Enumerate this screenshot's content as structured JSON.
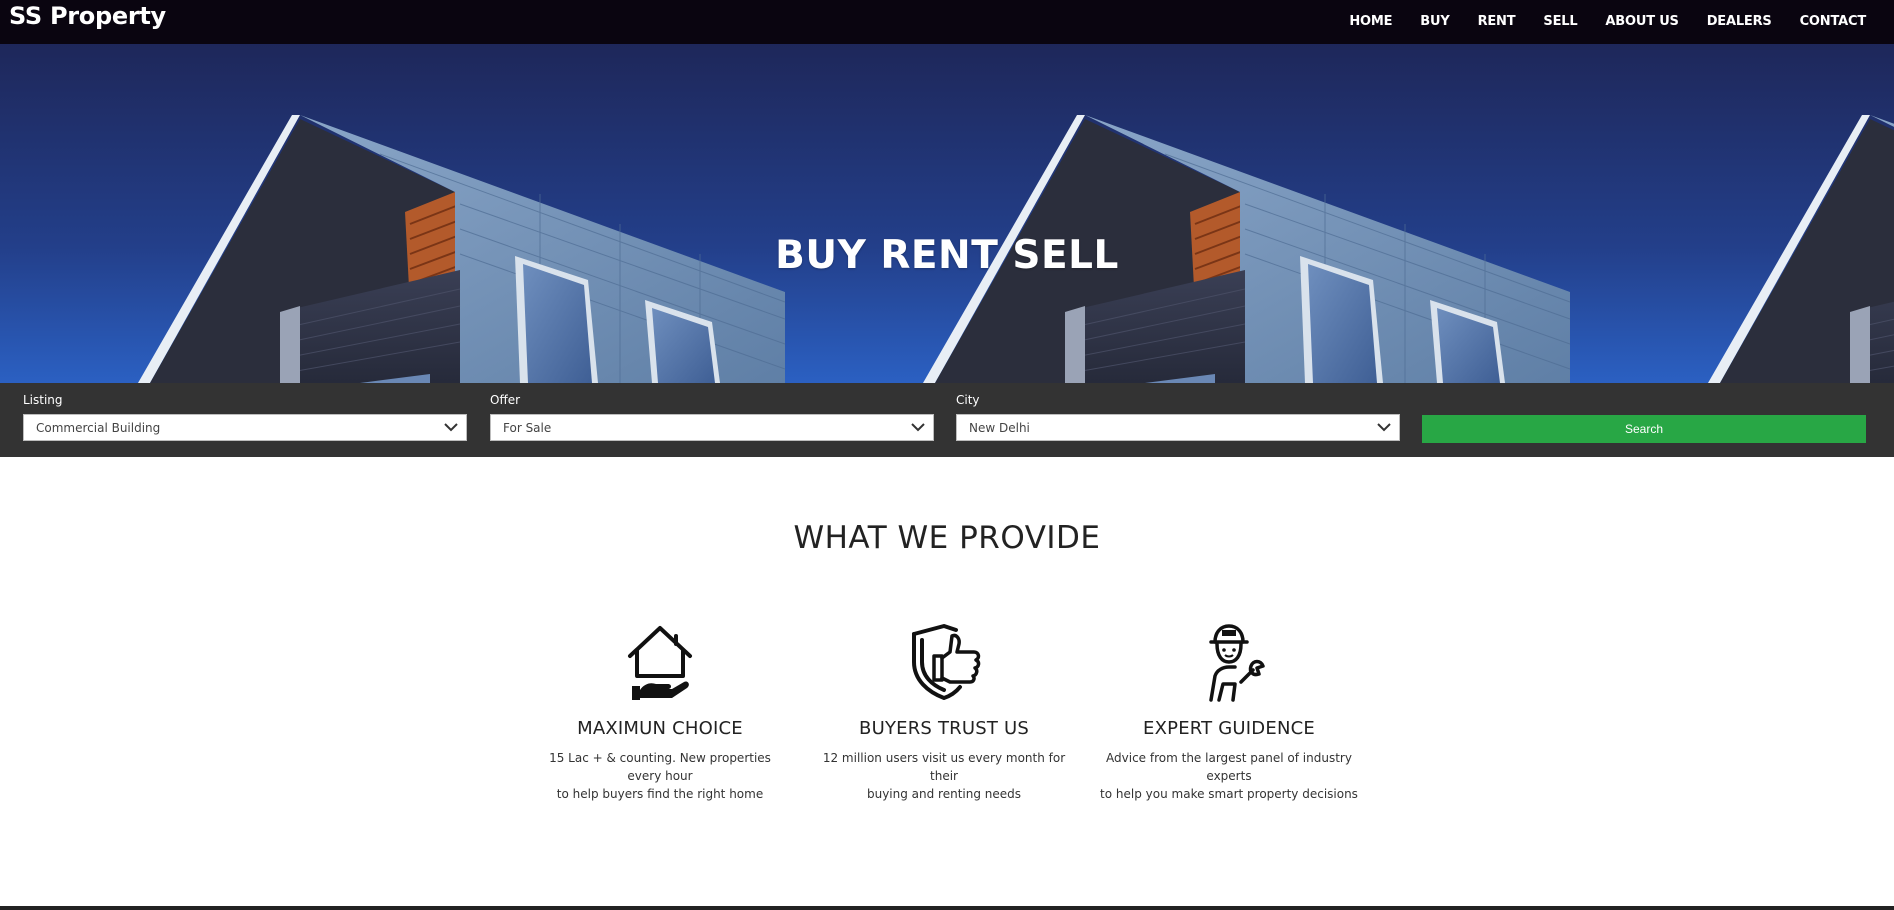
{
  "brand": {
    "name": "SS Property"
  },
  "nav": {
    "items": [
      {
        "label": "HOME"
      },
      {
        "label": "BUY"
      },
      {
        "label": "RENT"
      },
      {
        "label": "SELL"
      },
      {
        "label": "ABOUT US"
      },
      {
        "label": "DEALERS"
      },
      {
        "label": "CONTACT"
      }
    ]
  },
  "hero": {
    "title": "BUY RENT SELL"
  },
  "search": {
    "listing": {
      "label": "Listing",
      "value": "Commercial Building"
    },
    "offer": {
      "label": "Offer",
      "value": "For Sale"
    },
    "city": {
      "label": "City",
      "value": "New Delhi"
    },
    "button_label": "Search",
    "button_color": "#28a745"
  },
  "provide": {
    "title": "WHAT WE PROVIDE",
    "features": [
      {
        "icon": "house-hand-icon",
        "title": "MAXIMUN CHOICE",
        "desc_line1": "15 Lac + & counting. New properties every hour",
        "desc_line2": "to help buyers find the right home"
      },
      {
        "icon": "shield-thumbs-up-icon",
        "title": "BUYERS TRUST US",
        "desc_line1": "12 million users visit us every month for their",
        "desc_line2": "buying and renting needs"
      },
      {
        "icon": "expert-worker-icon",
        "title": "EXPERT GUIDENCE",
        "desc_line1": "Advice from the largest panel of industry experts",
        "desc_line2": "to help you make smart property decisions"
      }
    ]
  }
}
